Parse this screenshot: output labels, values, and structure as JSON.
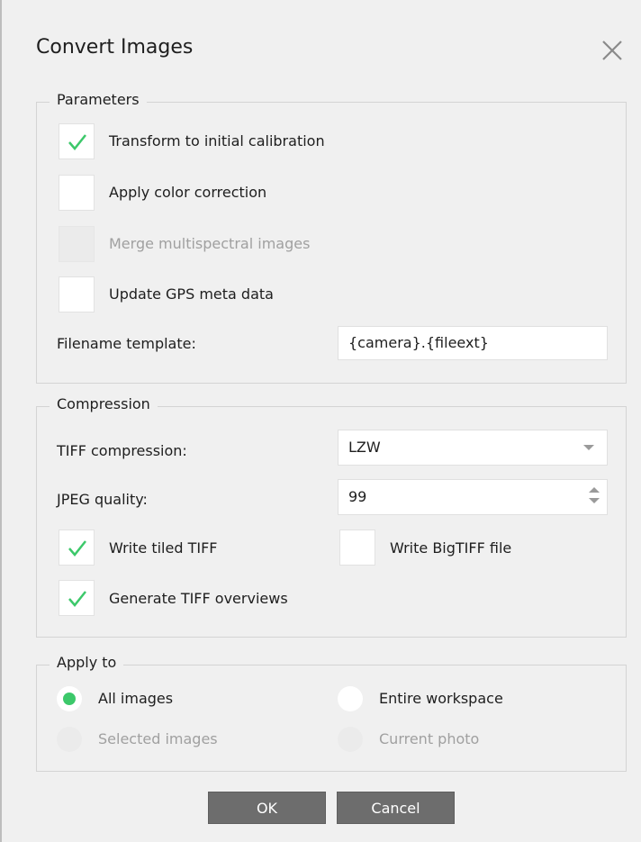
{
  "dialog": {
    "title": "Convert Images"
  },
  "parameters": {
    "group_title": "Parameters",
    "transform": {
      "label": "Transform to initial calibration",
      "checked": true
    },
    "color_correction": {
      "label": "Apply color correction",
      "checked": false
    },
    "merge_multispectral": {
      "label": "Merge multispectral images",
      "checked": false,
      "disabled": true
    },
    "update_gps": {
      "label": "Update GPS meta data",
      "checked": false
    },
    "filename_template": {
      "label": "Filename template:",
      "value": "{camera}.{fileext}"
    }
  },
  "compression": {
    "group_title": "Compression",
    "tiff_compression": {
      "label": "TIFF compression:",
      "value": "LZW"
    },
    "jpeg_quality": {
      "label": "JPEG quality:",
      "value": "99"
    },
    "write_tiled": {
      "label": "Write tiled TIFF",
      "checked": true
    },
    "write_bigtiff": {
      "label": "Write BigTIFF file",
      "checked": false
    },
    "generate_overviews": {
      "label": "Generate TIFF overviews",
      "checked": true
    }
  },
  "apply_to": {
    "group_title": "Apply to",
    "all_images": {
      "label": "All images",
      "selected": true
    },
    "entire_workspace": {
      "label": "Entire workspace",
      "selected": false
    },
    "selected_images": {
      "label": "Selected images",
      "disabled": true
    },
    "current_photo": {
      "label": "Current photo",
      "disabled": true
    }
  },
  "buttons": {
    "ok": "OK",
    "cancel": "Cancel"
  },
  "colors": {
    "check": "#3cc86a",
    "accent_radio": "#3cc86a",
    "button_bg": "#6d6d6d"
  },
  "icons": {
    "close": "close-icon",
    "check": "checkmark-icon"
  }
}
